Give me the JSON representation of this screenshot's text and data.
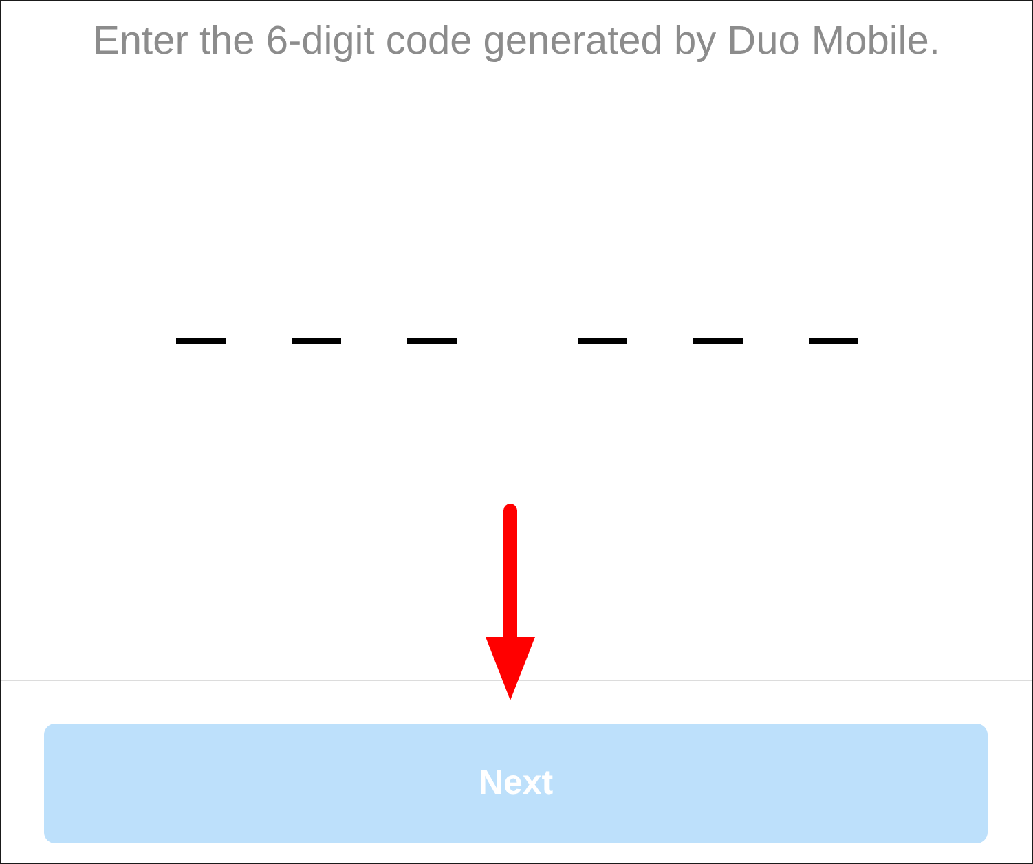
{
  "instruction": "Enter the 6-digit code generated by Duo Mobile.",
  "code_entry": {
    "groups": [
      {
        "slots": [
          {
            "kind": "blank"
          },
          {
            "kind": "blank"
          },
          {
            "kind": "blank"
          }
        ]
      },
      {
        "slots": [
          {
            "kind": "blank"
          },
          {
            "kind": "blank"
          },
          {
            "kind": "blank"
          }
        ]
      }
    ]
  },
  "annotations": [
    {
      "kind": "arrow"
    }
  ],
  "buttons": [
    {
      "label": "Next",
      "disabled": true
    }
  ]
}
